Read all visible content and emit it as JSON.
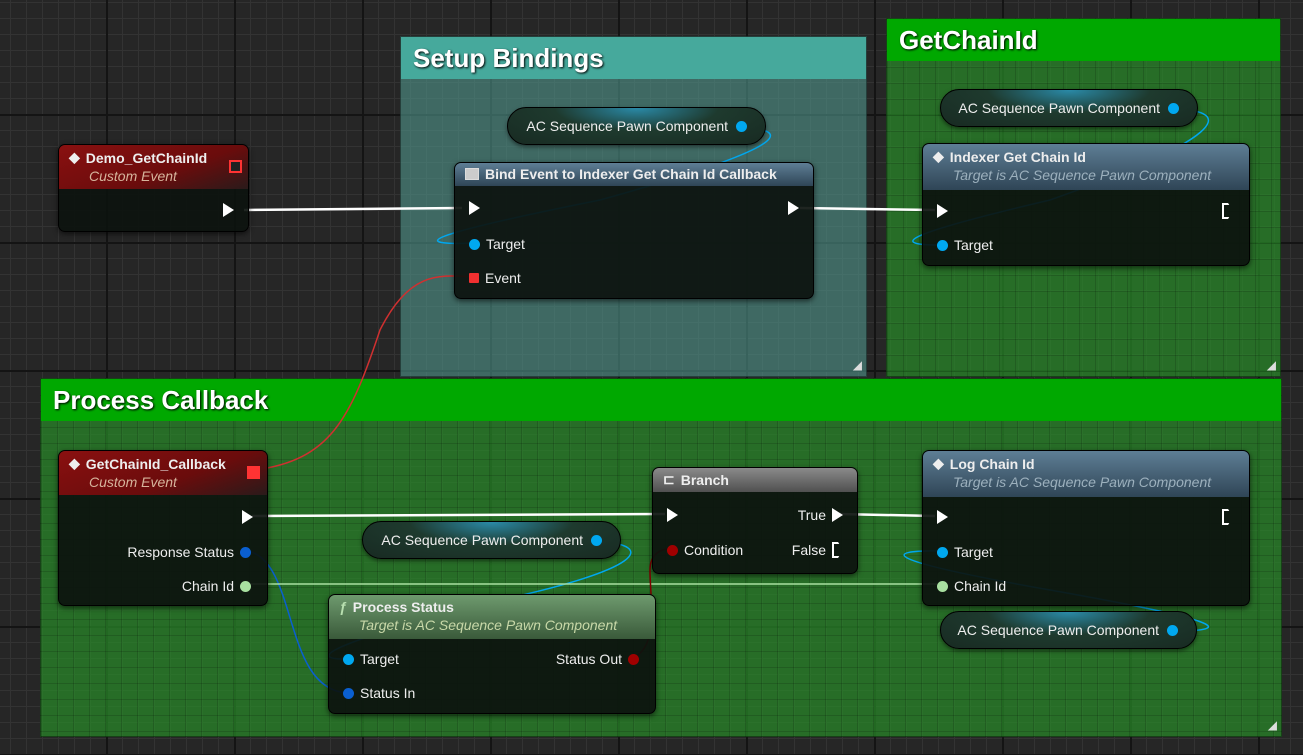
{
  "comments": {
    "setup": "Setup Bindings",
    "getchain": "GetChainId",
    "process": "Process Callback",
    "resize_grip": "◢"
  },
  "colors": {
    "exec": "#ffffff",
    "object": "#00a8f0",
    "delegate": "#f03030",
    "status": "#a00000",
    "chain_id": "#a8e0a0"
  },
  "nodes": {
    "demo": {
      "title": "Demo_GetChainId",
      "subtitle": "Custom Event",
      "icon": "event-diamond-icon"
    },
    "bind": {
      "title": "Bind Event to Indexer Get Chain Id Callback",
      "target": "Target",
      "event": "Event"
    },
    "indexer": {
      "title": "Indexer Get Chain Id",
      "subtitle": "Target is AC Sequence Pawn Component",
      "target": "Target"
    },
    "callback": {
      "title": "GetChainId_Callback",
      "subtitle": "Custom Event",
      "response": "Response Status",
      "chain": "Chain Id"
    },
    "branch": {
      "title": "Branch",
      "cond": "Condition",
      "true": "True",
      "false": "False"
    },
    "process": {
      "title": "Process Status",
      "subtitle": "Target is AC Sequence Pawn Component",
      "target": "Target",
      "status_in": "Status In",
      "status_out": "Status Out"
    },
    "log": {
      "title": "Log Chain Id",
      "subtitle": "Target is AC Sequence Pawn Component",
      "target": "Target",
      "chain": "Chain Id"
    }
  },
  "component_label": "AC Sequence Pawn Component"
}
